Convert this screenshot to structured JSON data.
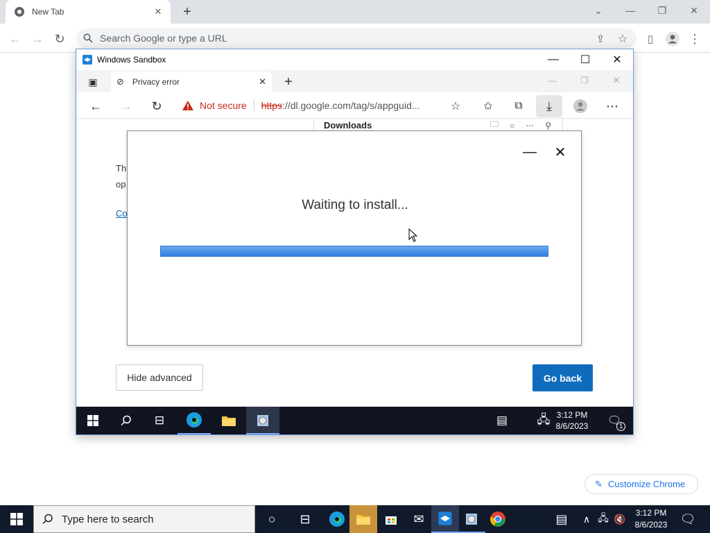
{
  "host_browser": {
    "tab_title": "New Tab",
    "omnibox_placeholder": "Search Google or type a URL",
    "customize_label": "Customize Chrome"
  },
  "sandbox_window": {
    "title": "Windows Sandbox",
    "edge": {
      "tab_title": "Privacy error",
      "not_secure_label": "Not secure",
      "url_scheme": "https",
      "url_rest": "://dl.google.com/tag/s/appguid...",
      "downloads_title": "Downloads",
      "page_text_line1": "Th",
      "page_text_line2": "op",
      "page_link": "Co",
      "hide_advanced_label": "Hide advanced",
      "go_back_label": "Go back"
    },
    "installer": {
      "message": "Waiting to install...",
      "progress_percent": 100
    },
    "taskbar": {
      "time": "3:12 PM",
      "date": "8/6/2023",
      "notification_count": "1"
    }
  },
  "taskbar": {
    "search_placeholder": "Type here to search",
    "time": "3:12 PM",
    "date": "8/6/2023"
  },
  "colors": {
    "go_back": "#0f6cbd",
    "not_secure": "#c42b1c",
    "progress": "#2f7fe0",
    "taskbar": "#101a2b"
  }
}
